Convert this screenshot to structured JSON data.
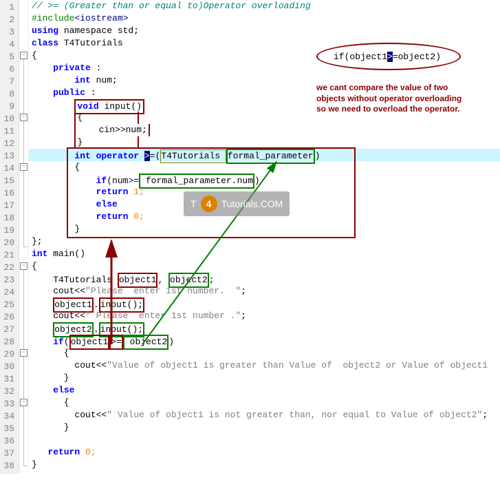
{
  "annotation": {
    "ellipse_text_prefix": "if(object1",
    "ellipse_op": ">",
    "ellipse_text_suffix": "=object2)",
    "note_l1": "we cant compare the value of two",
    "note_l2": "objects without operator overloading",
    "note_l3": "so we need to overload the operator."
  },
  "watermark": {
    "t": "T",
    "num": "4",
    "rest": "Tutorials.COM"
  },
  "lines": {
    "l1": "// >= (Greater than or equal to)Operator overloading",
    "l2a": "#include",
    "l2b": "<iostream>",
    "l3a": "using",
    "l3b": " namespace std;",
    "l4a": "class",
    "l4b": " T4Tutorials",
    "l5": "{",
    "l6a": "    private",
    "l6b": " :",
    "l7a": "        int",
    "l7b": " num;",
    "l8a": "    public",
    "l8b": " :",
    "l9a": "void",
    "l9b": " input()",
    "l10": "{",
    "l11": "    cin>>num;",
    "l12": "}",
    "l13a": "int",
    "l13b": " operator ",
    "l13op": ">",
    "l13c": "=(",
    "l13d": "T4Tutorials ",
    "l13e": "formal_parameter",
    "l13f": ")",
    "l14": "{",
    "l15a": "    if",
    "l15b": "(num",
    "l15c": ">=",
    "l15d": " formal_parameter.num",
    "l15e": ")",
    "l16a": "    return",
    "l16b": " 1;",
    "l17": "    else",
    "l18a": "    return",
    "l18b": " 0;",
    "l19": "}",
    "l20": "};",
    "l21a": "int",
    "l21b": " main()",
    "l22": "{",
    "l23a": "    T4Tutorials ",
    "l23b": "object1",
    "l23c": ", ",
    "l23d": "object2",
    "l23e": ";",
    "l24a": "    cout<<",
    "l24b": "\"Please  enter 1st number.  \"",
    "l24c": ";",
    "l25a": "object1",
    "l25b": ".",
    "l25c": "input();",
    "l26a": "    cout<<",
    "l26b": "\" Please  enter 1st number .\"",
    "l26c": ";",
    "l27a": "object2",
    "l27b": ".",
    "l27c": "input();",
    "l28a": "    if",
    "l28b": "(",
    "l28c": "object1",
    "l28d": ">=",
    "l28e": " object2",
    "l28f": ")",
    "l29": "      {",
    "l30a": "        cout<<",
    "l30b": "\"Value of object1 is greater than Value of  object2 or Value of object1",
    "l31": "      }",
    "l32": "    else",
    "l33": "      {",
    "l34a": "        cout<<",
    "l34b": "\" Value of object1 is not greater than, nor equal to Value of object2\"",
    "l34c": ";",
    "l35": "      }",
    "l36": "",
    "l37a": "   return",
    "l37b": " 0;",
    "l38": "}"
  },
  "line_numbers": [
    "1",
    "2",
    "3",
    "4",
    "5",
    "6",
    "7",
    "8",
    "9",
    "10",
    "11",
    "12",
    "13",
    "14",
    "15",
    "16",
    "17",
    "18",
    "19",
    "20",
    "21",
    "22",
    "23",
    "24",
    "25",
    "26",
    "27",
    "28",
    "29",
    "30",
    "31",
    "32",
    "33",
    "34",
    "35",
    "36",
    "37",
    "38"
  ]
}
